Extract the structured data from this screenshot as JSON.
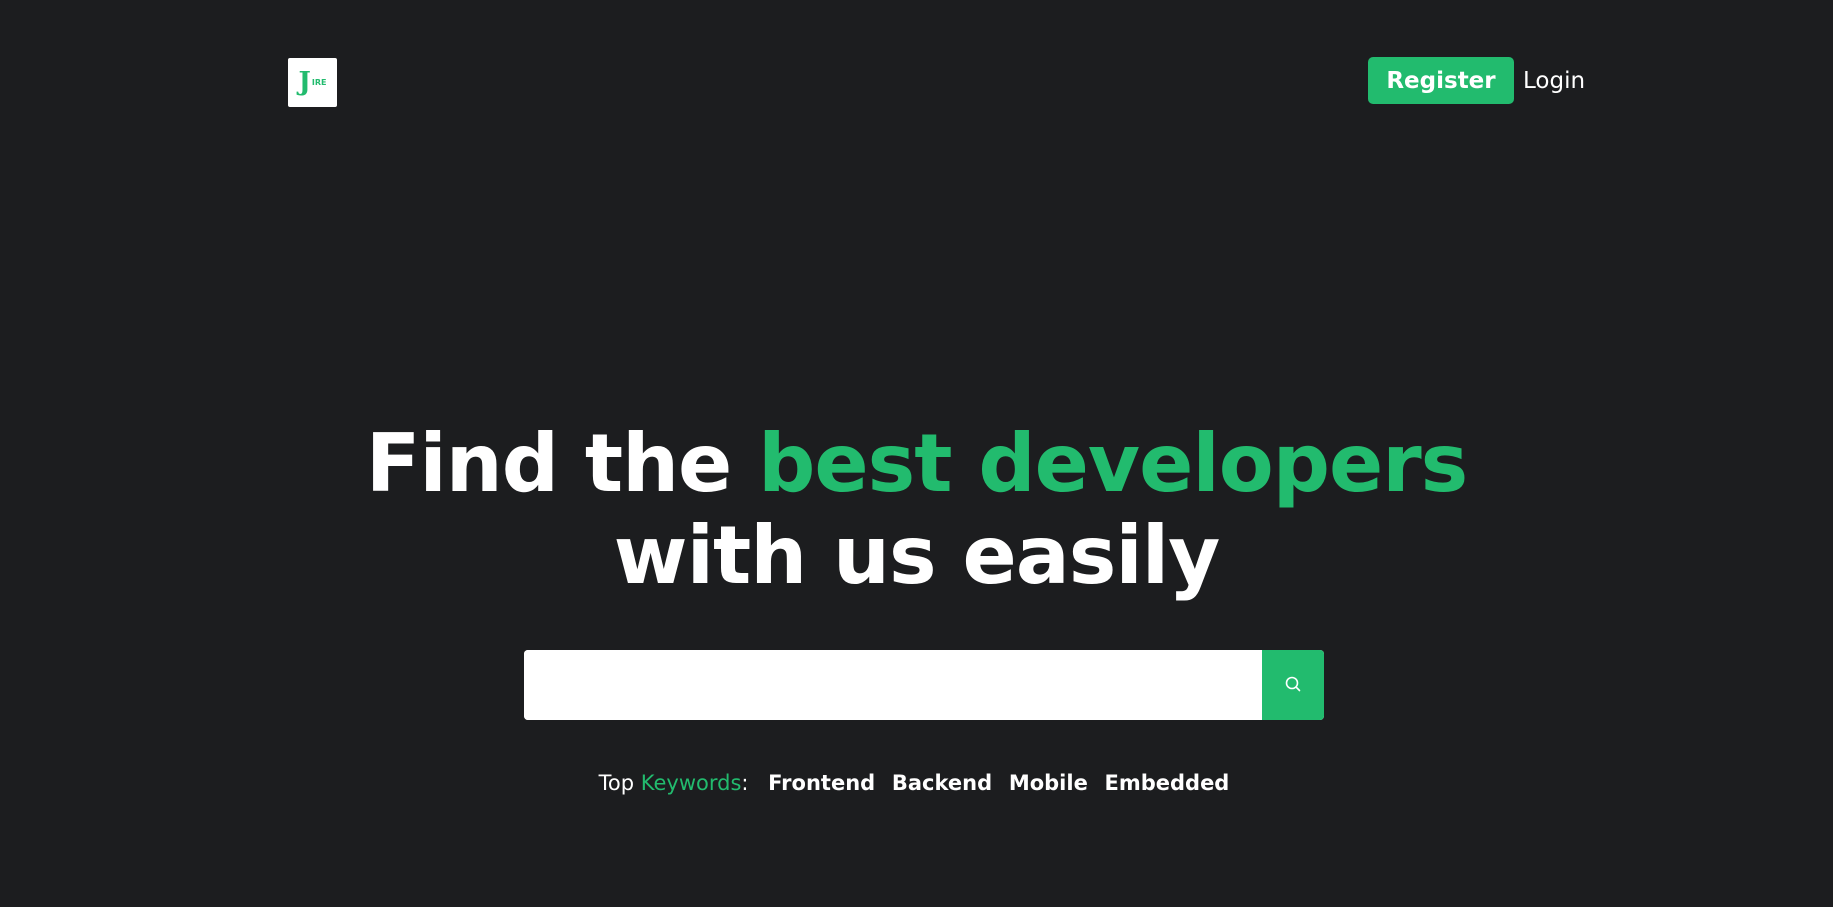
{
  "header": {
    "logo_text_j": "J",
    "logo_text_rest": "IRE",
    "register_label": "Register",
    "login_label": "Login"
  },
  "hero": {
    "title_line1_plain": "Find the ",
    "title_line1_accent": "best developers",
    "title_line2": "with us easily"
  },
  "search": {
    "value": "",
    "placeholder": "",
    "button_icon": "search-icon"
  },
  "keywords": {
    "prefix": "Top ",
    "label": "Keywords",
    "colon": ":",
    "items": [
      "Frontend",
      "Backend",
      "Mobile",
      "Embedded"
    ]
  },
  "colors": {
    "background": "#1c1d1f",
    "accent": "#22bb6e",
    "text": "#ffffff"
  }
}
